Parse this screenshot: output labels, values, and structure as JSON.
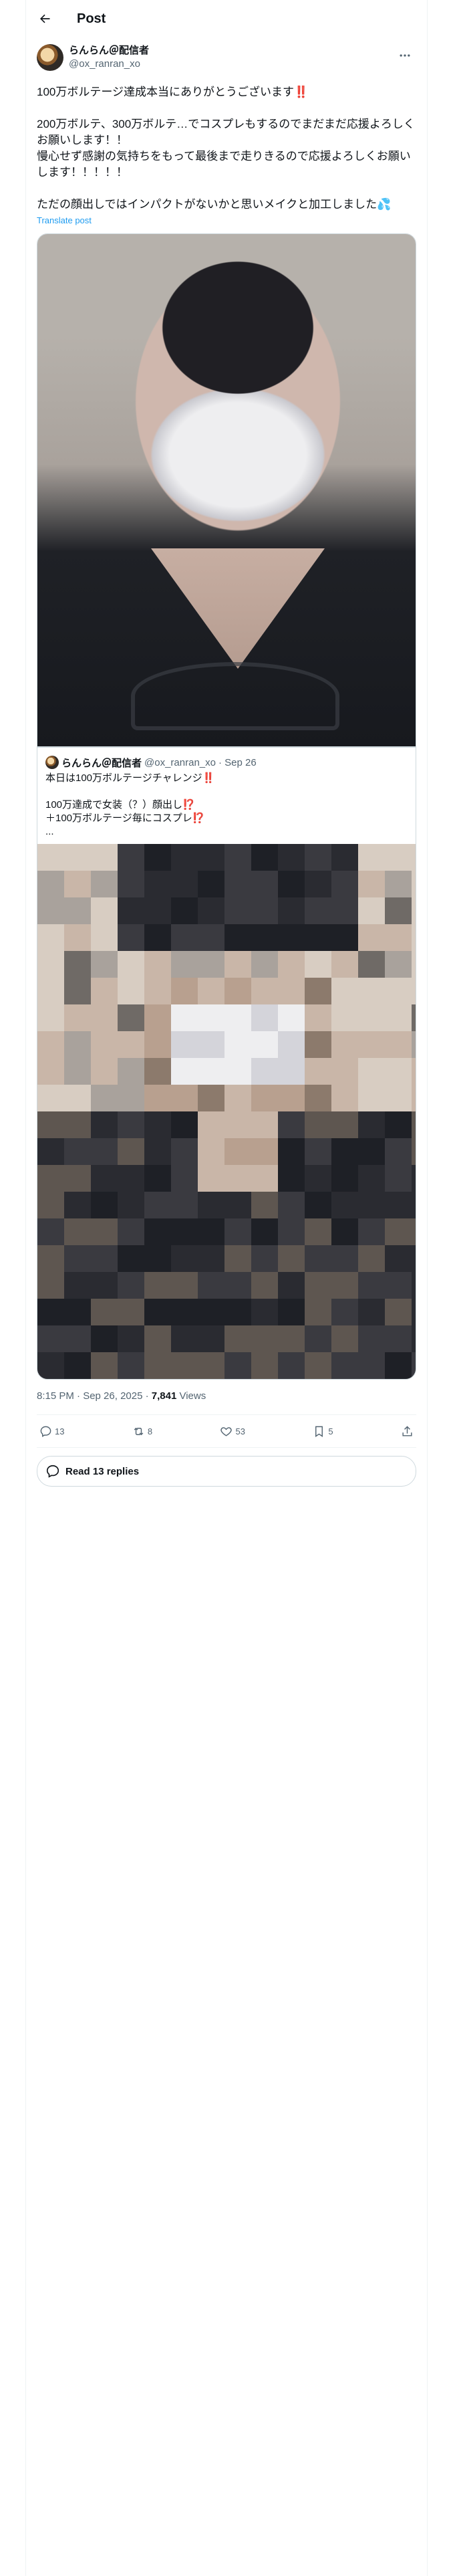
{
  "header": {
    "title": "Post"
  },
  "post": {
    "author": {
      "name": "らんらん＠配信者",
      "handle": "@ox_ranran_xo"
    },
    "text": "100万ボルテージ達成本当にありがとうございます‼️\n\n200万ボルテ、300万ボルテ…でコスプレもするのでまだまだ応援よろしくお願いします！！\n慢心せず感謝の気持ちをもって最後まで走りきるので応援よろしくお願いします！！！！！\n\nただの顔出しではインパクトがないかと思いメイクと加工しました💦",
    "translate_label": "Translate post",
    "quoted": {
      "name": "らんらん＠配信者",
      "handle": "@ox_ranran_xo",
      "date": "· Sep 26",
      "text": "本日は100万ボルテージチャレンジ‼️\n\n100万達成で女装（？）顔出し⁉️\n＋100万ボルテージ毎にコスプレ⁉️\n..."
    },
    "timestamp": "8:15 PM · Sep 26, 2025 · ",
    "views_count": "7,841",
    "views_label": " Views",
    "actions": {
      "replies": "13",
      "reposts": "8",
      "likes": "53",
      "bookmarks": "5"
    },
    "read_replies": "Read 13 replies"
  }
}
